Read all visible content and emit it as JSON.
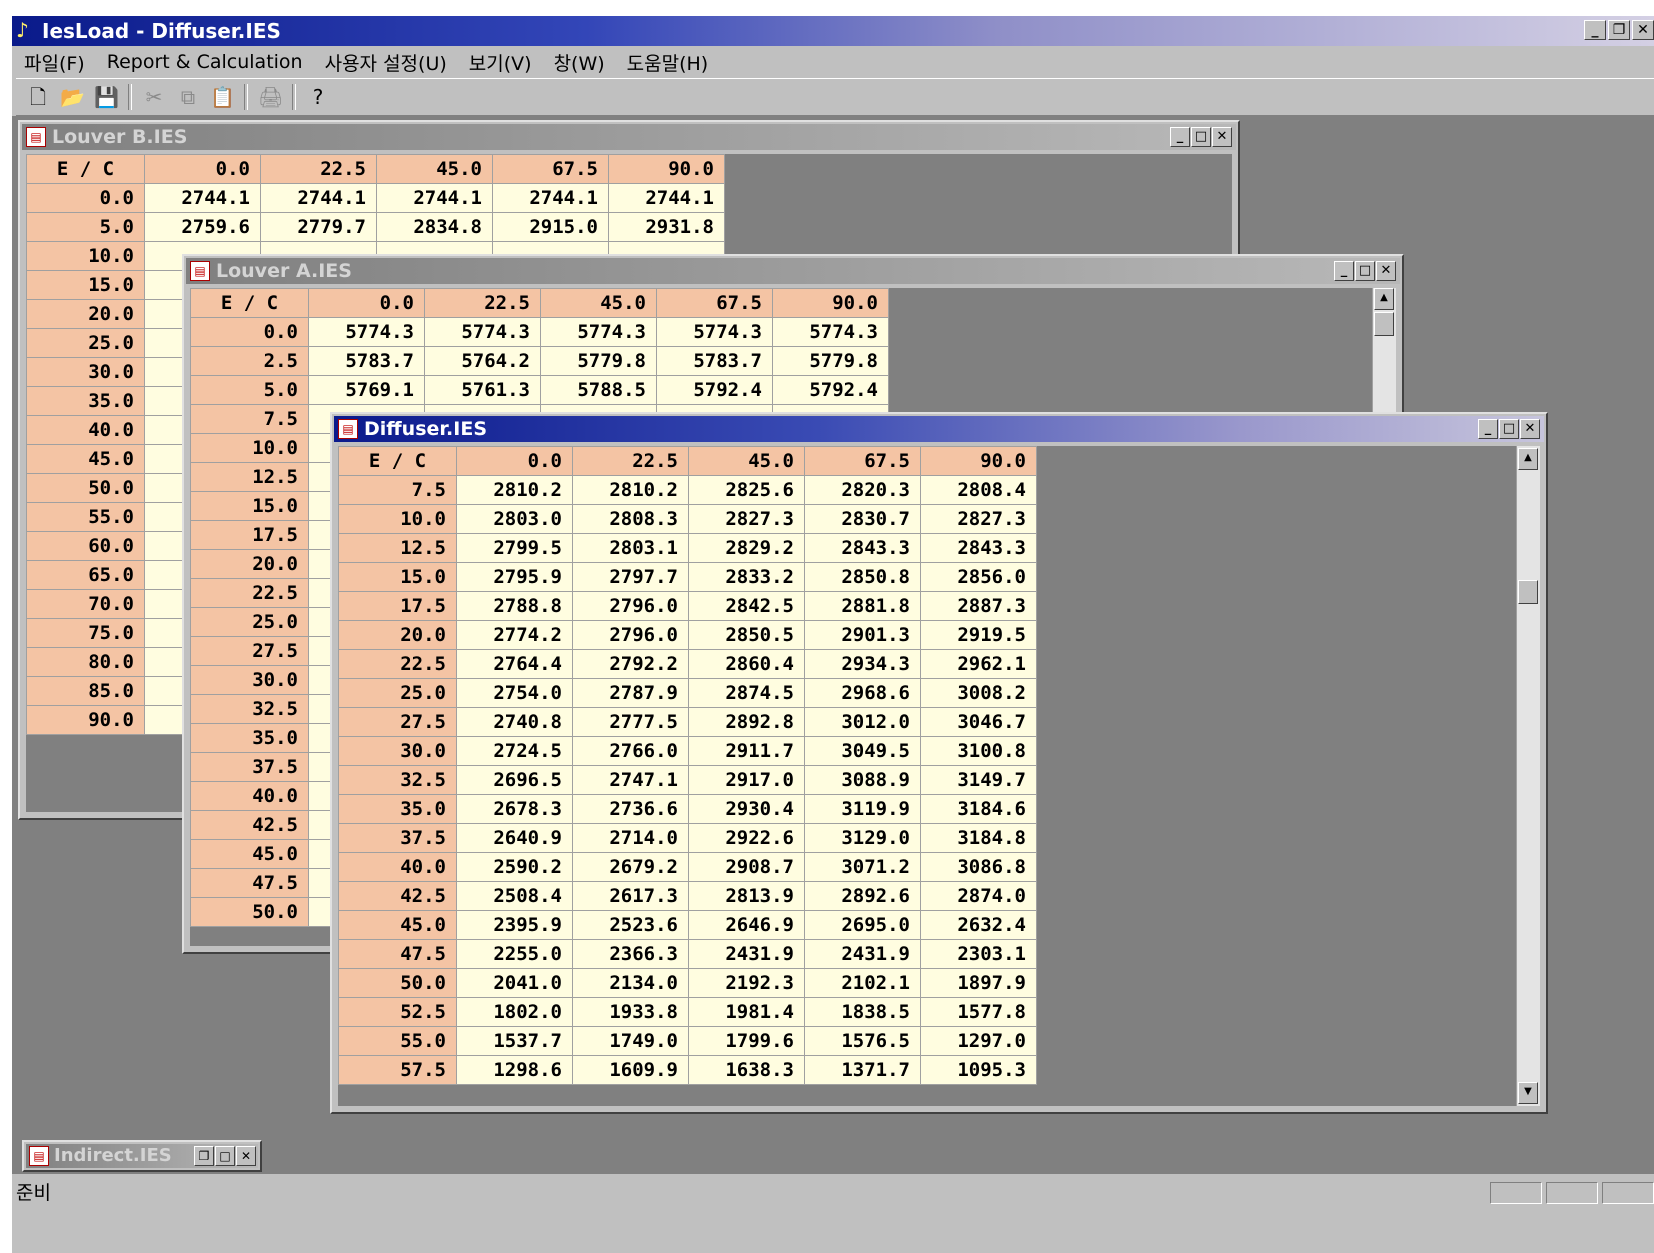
{
  "app": {
    "title": "IesLoad - Diffuser.IES",
    "icon": "app-logo-icon",
    "controls": {
      "minimize": "_",
      "restore": "❐",
      "close": "✕"
    }
  },
  "menu": [
    {
      "label": "파일(F)"
    },
    {
      "label": "Report & Calculation"
    },
    {
      "label": "사용자 설정(U)"
    },
    {
      "label": "보기(V)"
    },
    {
      "label": "창(W)"
    },
    {
      "label": "도움말(H)"
    }
  ],
  "toolbar": [
    {
      "name": "new-file-icon",
      "glyph": "🗋",
      "enabled": true
    },
    {
      "name": "open-folder-icon",
      "glyph": "📂",
      "enabled": true
    },
    {
      "name": "save-icon",
      "glyph": "💾",
      "enabled": true
    },
    {
      "name": "cut-icon",
      "glyph": "✂",
      "enabled": false
    },
    {
      "name": "copy-icon",
      "glyph": "⧉",
      "enabled": false
    },
    {
      "name": "paste-icon",
      "glyph": "📋",
      "enabled": false
    },
    {
      "name": "print-icon",
      "glyph": "🖨",
      "enabled": false
    },
    {
      "name": "help-icon",
      "glyph": "?",
      "enabled": true
    }
  ],
  "windows": {
    "louver_b": {
      "title": "Louver B.IES",
      "columns": [
        "E / C",
        "0.0",
        "22.5",
        "45.0",
        "67.5",
        "90.0"
      ],
      "rows": [
        [
          "0.0",
          "2744.1",
          "2744.1",
          "2744.1",
          "2744.1",
          "2744.1"
        ],
        [
          "5.0",
          "2759.6",
          "2779.7",
          "2834.8",
          "2915.0",
          "2931.8"
        ],
        [
          "10.0",
          "",
          "",
          "",
          "",
          ""
        ],
        [
          "15.0",
          "",
          "",
          "",
          "",
          ""
        ],
        [
          "20.0",
          "",
          "",
          "",
          "",
          ""
        ],
        [
          "25.0",
          "",
          "",
          "",
          "",
          ""
        ],
        [
          "30.0",
          "",
          "",
          "",
          "",
          ""
        ],
        [
          "35.0",
          "",
          "",
          "",
          "",
          ""
        ],
        [
          "40.0",
          "",
          "",
          "",
          "",
          ""
        ],
        [
          "45.0",
          "",
          "",
          "",
          "",
          ""
        ],
        [
          "50.0",
          "",
          "",
          "",
          "",
          ""
        ],
        [
          "55.0",
          "",
          "",
          "",
          "",
          ""
        ],
        [
          "60.0",
          "",
          "",
          "",
          "",
          ""
        ],
        [
          "65.0",
          "",
          "",
          "",
          "",
          ""
        ],
        [
          "70.0",
          "",
          "",
          "",
          "",
          ""
        ],
        [
          "75.0",
          "",
          "",
          "",
          "",
          ""
        ],
        [
          "80.0",
          "",
          "",
          "",
          "",
          ""
        ],
        [
          "85.0",
          "",
          "",
          "",
          "",
          ""
        ],
        [
          "90.0",
          "",
          "",
          "",
          "",
          ""
        ]
      ]
    },
    "louver_a": {
      "title": "Louver A.IES",
      "columns": [
        "E / C",
        "0.0",
        "22.5",
        "45.0",
        "67.5",
        "90.0"
      ],
      "rows": [
        [
          "0.0",
          "5774.3",
          "5774.3",
          "5774.3",
          "5774.3",
          "5774.3"
        ],
        [
          "2.5",
          "5783.7",
          "5764.2",
          "5779.8",
          "5783.7",
          "5779.8"
        ],
        [
          "5.0",
          "5769.1",
          "5761.3",
          "5788.5",
          "5792.4",
          "5792.4"
        ],
        [
          "7.5",
          "",
          "",
          "",
          "",
          ""
        ],
        [
          "10.0",
          "",
          "",
          "",
          "",
          ""
        ],
        [
          "12.5",
          "",
          "",
          "",
          "",
          ""
        ],
        [
          "15.0",
          "",
          "",
          "",
          "",
          ""
        ],
        [
          "17.5",
          "",
          "",
          "",
          "",
          ""
        ],
        [
          "20.0",
          "",
          "",
          "",
          "",
          ""
        ],
        [
          "22.5",
          "",
          "",
          "",
          "",
          ""
        ],
        [
          "25.0",
          "",
          "",
          "",
          "",
          ""
        ],
        [
          "27.5",
          "",
          "",
          "",
          "",
          ""
        ],
        [
          "30.0",
          "",
          "",
          "",
          "",
          ""
        ],
        [
          "32.5",
          "",
          "",
          "",
          "",
          ""
        ],
        [
          "35.0",
          "",
          "",
          "",
          "",
          ""
        ],
        [
          "37.5",
          "",
          "",
          "",
          "",
          ""
        ],
        [
          "40.0",
          "",
          "",
          "",
          "",
          ""
        ],
        [
          "42.5",
          "",
          "",
          "",
          "",
          ""
        ],
        [
          "45.0",
          "",
          "",
          "",
          "",
          ""
        ],
        [
          "47.5",
          "",
          "",
          "",
          "",
          ""
        ],
        [
          "50.0",
          "",
          "",
          "",
          "",
          ""
        ]
      ]
    },
    "diffuser": {
      "title": "Diffuser.IES",
      "columns": [
        "E / C",
        "0.0",
        "22.5",
        "45.0",
        "67.5",
        "90.0"
      ],
      "rows": [
        [
          "7.5",
          "2810.2",
          "2810.2",
          "2825.6",
          "2820.3",
          "2808.4"
        ],
        [
          "10.0",
          "2803.0",
          "2808.3",
          "2827.3",
          "2830.7",
          "2827.3"
        ],
        [
          "12.5",
          "2799.5",
          "2803.1",
          "2829.2",
          "2843.3",
          "2843.3"
        ],
        [
          "15.0",
          "2795.9",
          "2797.7",
          "2833.2",
          "2850.8",
          "2856.0"
        ],
        [
          "17.5",
          "2788.8",
          "2796.0",
          "2842.5",
          "2881.8",
          "2887.3"
        ],
        [
          "20.0",
          "2774.2",
          "2796.0",
          "2850.5",
          "2901.3",
          "2919.5"
        ],
        [
          "22.5",
          "2764.4",
          "2792.2",
          "2860.4",
          "2934.3",
          "2962.1"
        ],
        [
          "25.0",
          "2754.0",
          "2787.9",
          "2874.5",
          "2968.6",
          "3008.2"
        ],
        [
          "27.5",
          "2740.8",
          "2777.5",
          "2892.8",
          "3012.0",
          "3046.7"
        ],
        [
          "30.0",
          "2724.5",
          "2766.0",
          "2911.7",
          "3049.5",
          "3100.8"
        ],
        [
          "32.5",
          "2696.5",
          "2747.1",
          "2917.0",
          "3088.9",
          "3149.7"
        ],
        [
          "35.0",
          "2678.3",
          "2736.6",
          "2930.4",
          "3119.9",
          "3184.6"
        ],
        [
          "37.5",
          "2640.9",
          "2714.0",
          "2922.6",
          "3129.0",
          "3184.8"
        ],
        [
          "40.0",
          "2590.2",
          "2679.2",
          "2908.7",
          "3071.2",
          "3086.8"
        ],
        [
          "42.5",
          "2508.4",
          "2617.3",
          "2813.9",
          "2892.6",
          "2874.0"
        ],
        [
          "45.0",
          "2395.9",
          "2523.6",
          "2646.9",
          "2695.0",
          "2632.4"
        ],
        [
          "47.5",
          "2255.0",
          "2366.3",
          "2431.9",
          "2431.9",
          "2303.1"
        ],
        [
          "50.0",
          "2041.0",
          "2134.0",
          "2192.3",
          "2102.1",
          "1897.9"
        ],
        [
          "52.5",
          "1802.0",
          "1933.8",
          "1981.4",
          "1838.5",
          "1577.8"
        ],
        [
          "55.0",
          "1537.7",
          "1749.0",
          "1799.6",
          "1576.5",
          "1297.0"
        ],
        [
          "57.5",
          "1298.6",
          "1609.9",
          "1638.3",
          "1371.7",
          "1095.3"
        ]
      ]
    },
    "indirect": {
      "title": "Indirect.IES"
    }
  },
  "status": {
    "text": "준비"
  }
}
